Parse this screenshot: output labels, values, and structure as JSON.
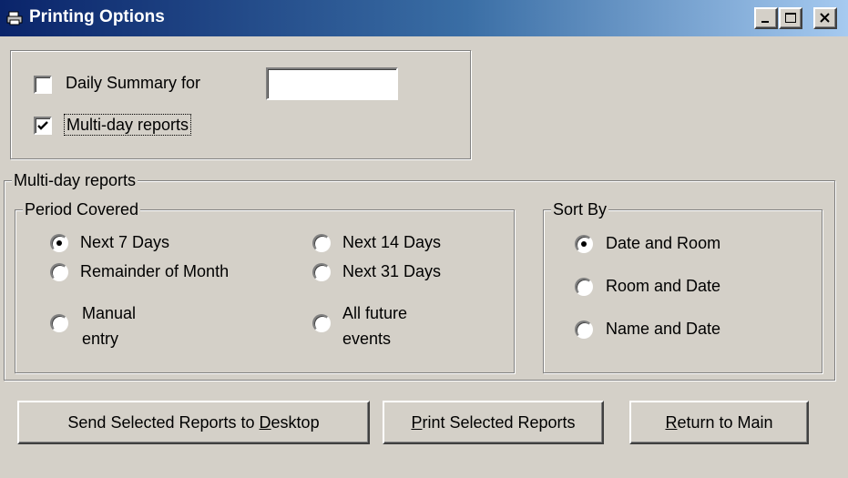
{
  "window": {
    "title": "Printing Options",
    "icons": {
      "app": "printer-icon",
      "minimize": "minimize-icon",
      "maximize": "maximize-icon",
      "close": "close-icon"
    }
  },
  "top_options": {
    "daily_summary": {
      "label": "Daily Summary for",
      "checked": false,
      "date_value": ""
    },
    "multi_day": {
      "label": "Multi-day reports",
      "checked": true
    }
  },
  "multi_day_frame": {
    "legend": "Multi-day reports",
    "period": {
      "legend": "Period Covered",
      "options": [
        {
          "label": "Next 7 Days",
          "checked": true
        },
        {
          "label": "Remainder of Month",
          "checked": false
        },
        {
          "label": "Manual\nentry",
          "checked": false
        },
        {
          "label": "Next 14 Days",
          "checked": false
        },
        {
          "label": "Next 31 Days",
          "checked": false
        },
        {
          "label": "All future\nevents",
          "checked": false
        }
      ]
    },
    "sort": {
      "legend": "Sort By",
      "options": [
        {
          "label": "Date and Room",
          "checked": true
        },
        {
          "label": "Room and Date",
          "checked": false
        },
        {
          "label": "Name and Date",
          "checked": false
        }
      ]
    }
  },
  "buttons": {
    "send": {
      "pre": "Send Selected Reports to ",
      "accel": "D",
      "post": "esktop"
    },
    "print": {
      "pre": "",
      "accel": "P",
      "post": "rint Selected Reports"
    },
    "return": {
      "pre": "",
      "accel": "R",
      "post": "eturn to Main"
    }
  }
}
